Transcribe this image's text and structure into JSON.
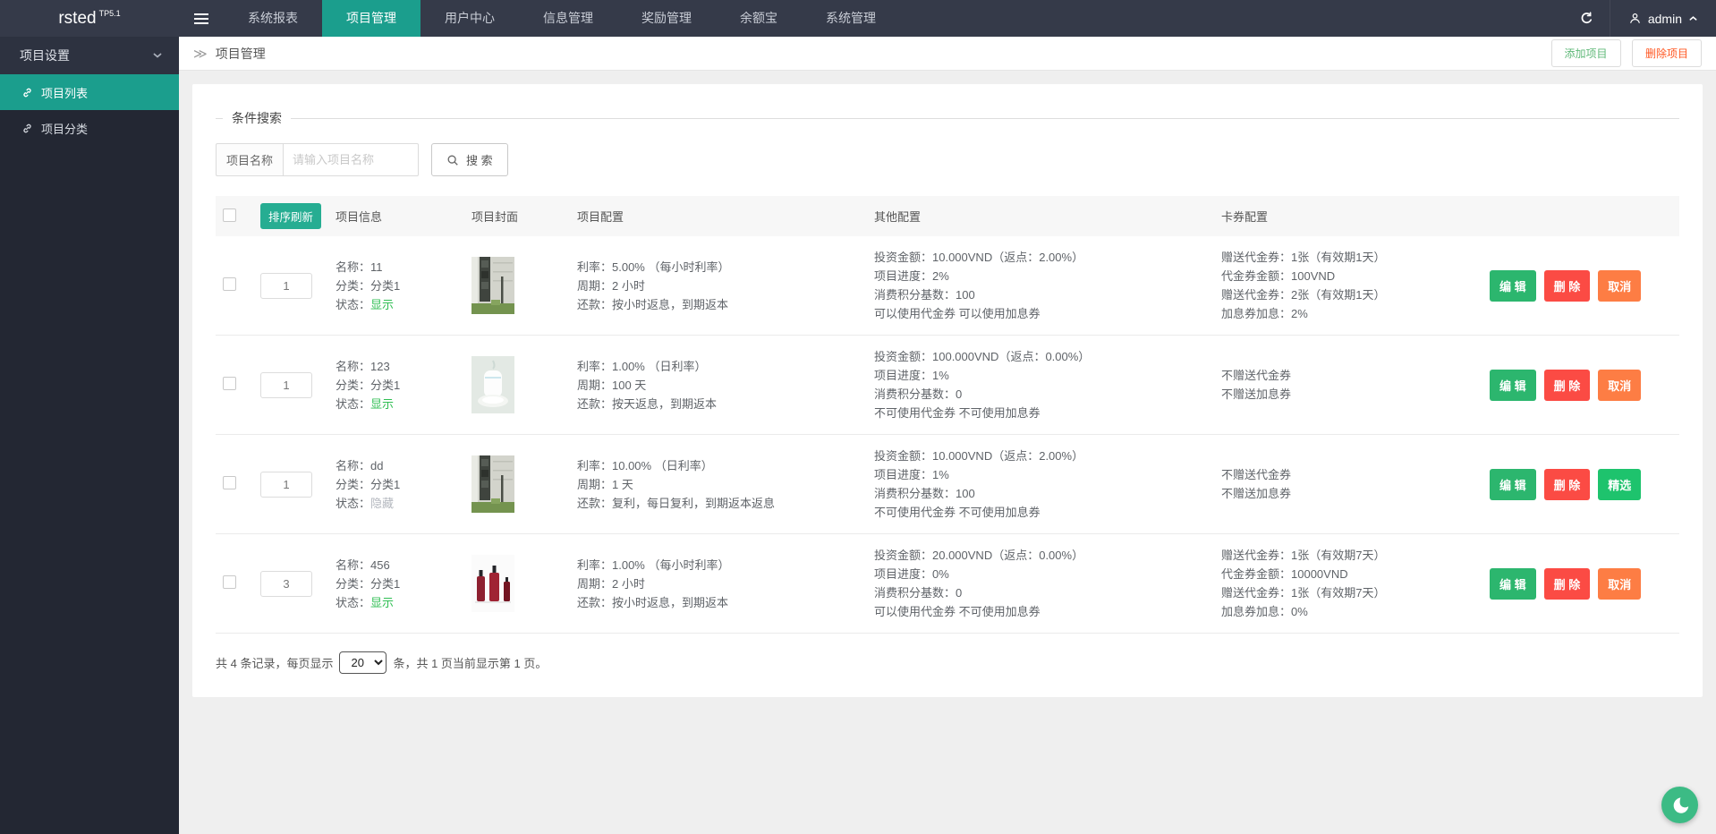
{
  "colors": {
    "accent_teal": "#1b9e8d",
    "sort_button": "#26ad92",
    "status_on": "#2fbe52",
    "status_off": "#b4b8bf",
    "edit": "#2cb66e",
    "delete": "#fb4b44",
    "cancel": "#fd7d44",
    "featured": "#1ec36d",
    "add_text": "#5FB878",
    "delete_text": "#FF5722",
    "topbar_bg": "#353a49",
    "sidebar_bg": "#232733",
    "fab": "#3cbb85"
  },
  "header": {
    "logo": "rsted",
    "logo_version": "TP5.1",
    "nav": [
      {
        "key": "system-reports",
        "label": "系统报表",
        "active": false
      },
      {
        "key": "project-management",
        "label": "项目管理",
        "active": true
      },
      {
        "key": "user-center",
        "label": "用户中心",
        "active": false
      },
      {
        "key": "info-management",
        "label": "信息管理",
        "active": false
      },
      {
        "key": "reward-management",
        "label": "奖励管理",
        "active": false
      },
      {
        "key": "yuebao",
        "label": "余额宝",
        "active": false
      },
      {
        "key": "system-management",
        "label": "系统管理",
        "active": false
      }
    ],
    "user": "admin"
  },
  "sidebar": {
    "group": "项目设置",
    "items": [
      {
        "key": "project-list",
        "label": "项目列表",
        "active": true
      },
      {
        "key": "project-category",
        "label": "项目分类",
        "active": false
      }
    ]
  },
  "breadcrumb": "项目管理",
  "page_actions": {
    "add": "添加项目",
    "delete": "删除项目"
  },
  "search": {
    "legend": "条件搜索",
    "label": "项目名称",
    "placeholder": "请输入项目名称",
    "button": "搜 索"
  },
  "table": {
    "sort_refresh": "排序刷新",
    "headers": [
      "项目信息",
      "项目封面",
      "项目配置",
      "其他配置",
      "卡券配置"
    ],
    "info_labels": {
      "name": "名称：",
      "category": "分类：",
      "status": "状态："
    },
    "rows": [
      {
        "sort": "1",
        "name": "11",
        "category": "分类1",
        "status": "显示",
        "status_visible": true,
        "cover": "building",
        "config": [
          "利率：5.00% （每小时利率）",
          "周期：2 小时",
          "还款：按小时返息，到期返本"
        ],
        "other": [
          "投资金额：10.000VND（返点：2.00%）",
          "项目进度：2%",
          "消费积分基数：100",
          "可以使用代金券  可以使用加息券"
        ],
        "cards": [
          "赠送代金券：1张（有效期1天）",
          "代金券金额：100VND",
          "赠送代金券：2张（有效期1天）",
          "加息券加息：2%"
        ],
        "actions": [
          {
            "label": "编 辑",
            "type": "edit"
          },
          {
            "label": "删 除",
            "type": "delete"
          },
          {
            "label": "取消",
            "type": "cancel"
          }
        ]
      },
      {
        "sort": "1",
        "name": "123",
        "category": "分类1",
        "status": "显示",
        "status_visible": true,
        "cover": "humidifier",
        "config": [
          "利率：1.00% （日利率）",
          "周期：100 天",
          "还款：按天返息，到期返本"
        ],
        "other": [
          "投资金额：100.000VND（返点：0.00%）",
          "项目进度：1%",
          "消费积分基数：0",
          "不可使用代金券  不可使用加息券"
        ],
        "cards": [
          "不赠送代金券",
          "不赠送加息券"
        ],
        "actions": [
          {
            "label": "编 辑",
            "type": "edit"
          },
          {
            "label": "删 除",
            "type": "delete"
          },
          {
            "label": "取消",
            "type": "cancel"
          }
        ]
      },
      {
        "sort": "1",
        "name": "dd",
        "category": "分类1",
        "status": "隐藏",
        "status_visible": false,
        "cover": "building",
        "config": [
          "利率：10.00% （日利率）",
          "周期：1 天",
          "还款：复利，每日复利，到期返本返息"
        ],
        "other": [
          "投资金额：10.000VND（返点：2.00%）",
          "项目进度：1%",
          "消费积分基数：100",
          "不可使用代金券  不可使用加息券"
        ],
        "cards": [
          "不赠送代金券",
          "不赠送加息券"
        ],
        "actions": [
          {
            "label": "编 辑",
            "type": "edit"
          },
          {
            "label": "删 除",
            "type": "delete"
          },
          {
            "label": "精选",
            "type": "featured"
          }
        ]
      },
      {
        "sort": "3",
        "name": "456",
        "category": "分类1",
        "status": "显示",
        "status_visible": true,
        "cover": "bottles",
        "config": [
          "利率：1.00% （每小时利率）",
          "周期：2 小时",
          "还款：按小时返息，到期返本"
        ],
        "other": [
          "投资金额：20.000VND（返点：0.00%）",
          "项目进度：0%",
          "消费积分基数：0",
          "可以使用代金券  不可使用加息券"
        ],
        "cards": [
          "赠送代金券：1张（有效期7天）",
          "代金券金额：10000VND",
          "赠送代金券：1张（有效期7天）",
          "加息券加息：0%"
        ],
        "actions": [
          {
            "label": "编 辑",
            "type": "edit"
          },
          {
            "label": "删 除",
            "type": "delete"
          },
          {
            "label": "取消",
            "type": "cancel"
          }
        ]
      }
    ]
  },
  "pagination": {
    "prefix": "共 4 条记录，每页显示",
    "per_page": "20",
    "suffix": "条，共 1 页当前显示第 1 页。"
  }
}
